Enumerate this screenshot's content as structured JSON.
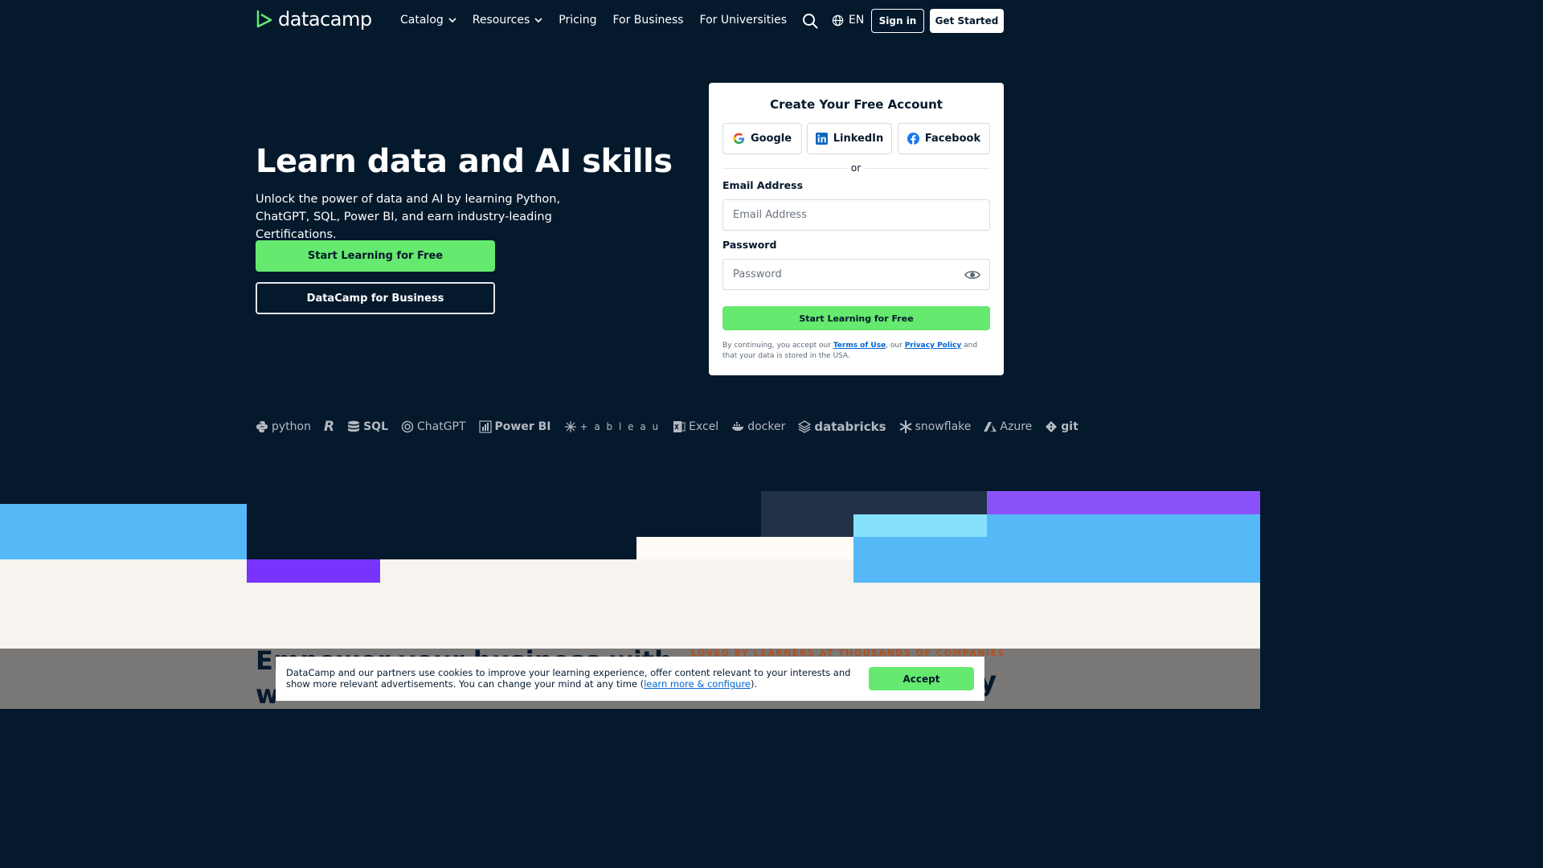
{
  "header": {
    "logo_text": "datacamp",
    "nav": [
      {
        "label": "Catalog",
        "dropdown": true
      },
      {
        "label": "Resources",
        "dropdown": true
      },
      {
        "label": "Pricing",
        "dropdown": false
      },
      {
        "label": "For Business",
        "dropdown": false
      },
      {
        "label": "For Universities",
        "dropdown": false
      }
    ],
    "language": "EN",
    "signin_label": "Sign in",
    "get_started_label": "Get Started"
  },
  "hero": {
    "title": "Learn data and AI skills",
    "subtitle": "Unlock the power of data and AI by learning Python, ChatGPT, SQL, Power BI, and earn industry-leading Certifications.",
    "primary_cta": "Start Learning for Free",
    "secondary_cta": "DataCamp for Business"
  },
  "signup": {
    "title": "Create Your Free Account",
    "google": "Google",
    "linkedin": "LinkedIn",
    "facebook": "Facebook",
    "or": "or",
    "email_label": "Email Address",
    "email_placeholder": "Email Address",
    "password_label": "Password",
    "password_placeholder": "Password",
    "submit": "Start Learning for Free",
    "legal_prefix": "By continuing, you accept our ",
    "terms": "Terms of Use",
    "legal_mid": ", our ",
    "privacy": "Privacy Policy",
    "legal_suffix": " and that your data is stored in the USA."
  },
  "tech_logos": [
    "python",
    "R",
    "SQL",
    "ChatGPT",
    "Power BI",
    "+ a b l e a u",
    "Excel",
    "docker",
    "databricks",
    "snowflake",
    "Azure",
    "git"
  ],
  "below": {
    "title_line1": "Empower your business with",
    "title_line2": "w",
    "loved": "LOVED BY LEARNERS AT THOUSANDS OF COMPANIES",
    "trailing_letter": "y"
  },
  "cookie": {
    "text": "DataCamp and our partners use cookies to improve your learning experience, offer content relevant to your interests and show more relevant advertisements. You can change your mind at any time (",
    "link": "learn more & configure",
    "text_end": ").",
    "accept": "Accept"
  },
  "colors": {
    "navy": "#05192d",
    "green": "#65e96e",
    "blue": "#56b9f7",
    "purple": "#7933ff",
    "cream": "#f7f3ee"
  }
}
